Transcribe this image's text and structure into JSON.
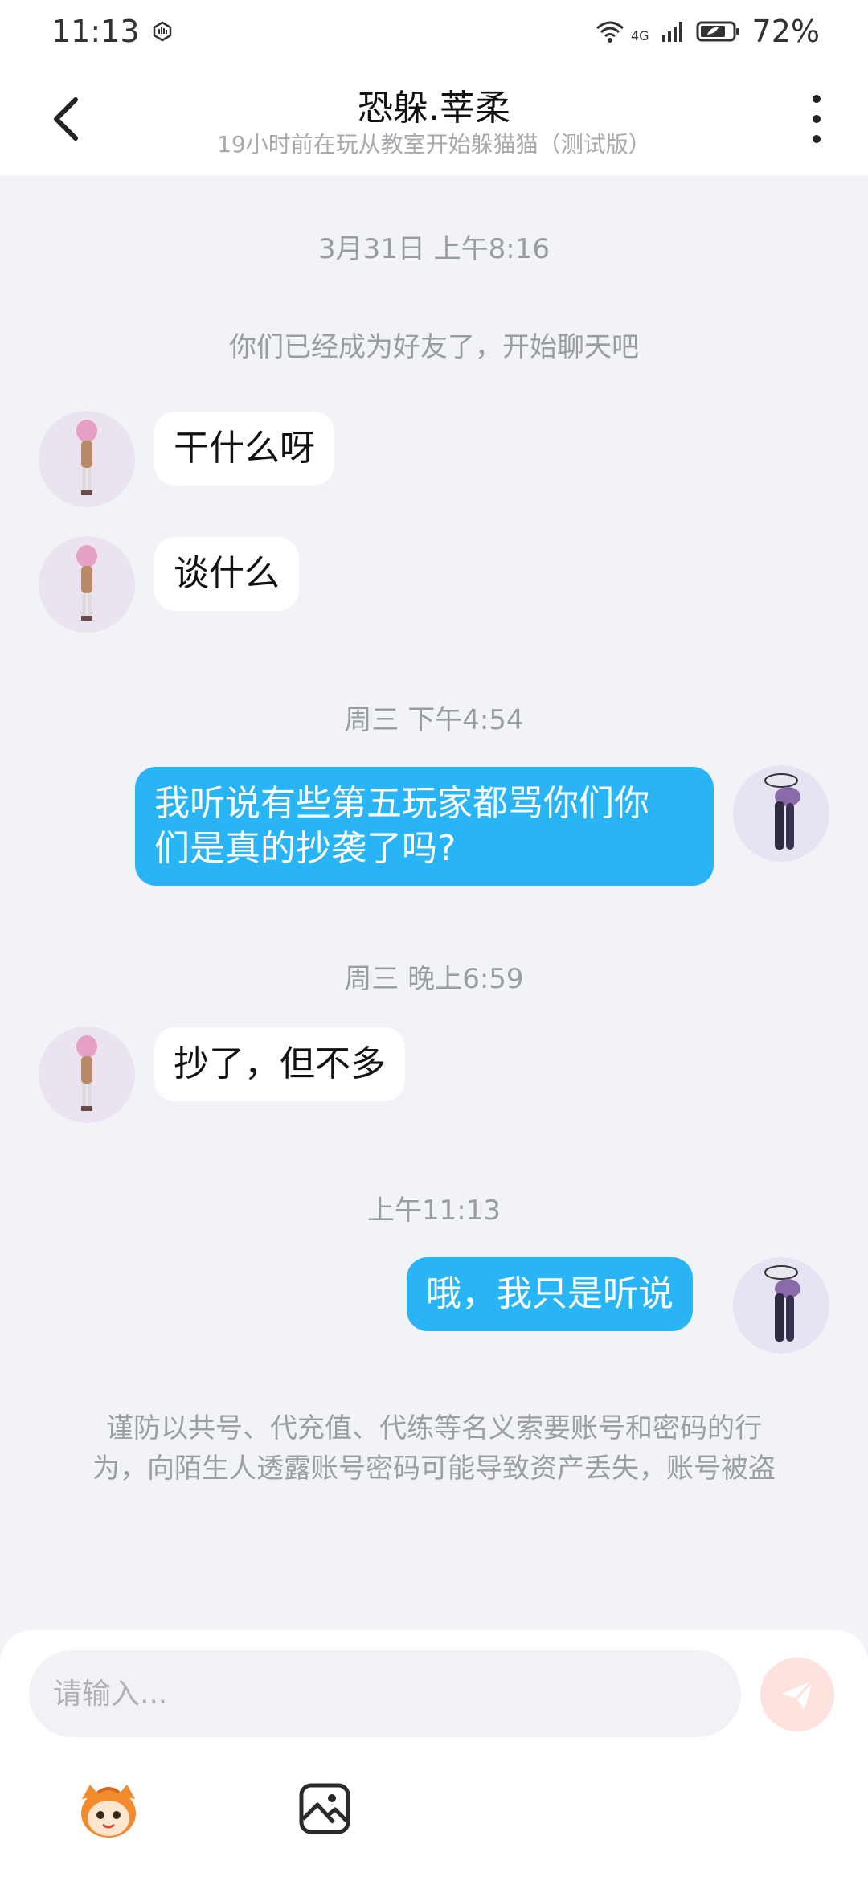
{
  "statusbar": {
    "time": "11:13",
    "network": "4G",
    "battery": "72%"
  },
  "header": {
    "title": "恐躲.莘柔",
    "subtitle": "19小时前在玩从教室开始躲猫猫（测试版）"
  },
  "chat": {
    "timestamps": [
      "3月31日 上午8:16",
      "周三 下午4:54",
      "周三 晚上6:59",
      "上午11:13"
    ],
    "system_message": "你们已经成为好友了，开始聊天吧",
    "messages": [
      {
        "from": "them",
        "text": "干什么呀"
      },
      {
        "from": "them",
        "text": "谈什么"
      },
      {
        "from": "me",
        "line1": "我听说有些第五玩家都骂你们你",
        "line2": "们是真的抄袭了吗?"
      },
      {
        "from": "them",
        "text": "抄了，但不多"
      },
      {
        "from": "me",
        "text": "哦，我只是听说"
      }
    ],
    "notice_line1": "谨防以共号、代充值、代练等名义索要账号和密码的行",
    "notice_line2": "为，向陌生人透露账号密码可能导致资产丢失，账号被盗"
  },
  "input": {
    "placeholder": "请输入...",
    "value": ""
  },
  "icons": {
    "back": "chevron-left-icon",
    "more": "more-vertical-icon",
    "send": "send-icon",
    "emoji": "sticker-icon",
    "image": "image-icon"
  },
  "colors": {
    "accent": "#29b4f6",
    "background": "#f1f3f7",
    "send_disabled": "#fde2de"
  }
}
